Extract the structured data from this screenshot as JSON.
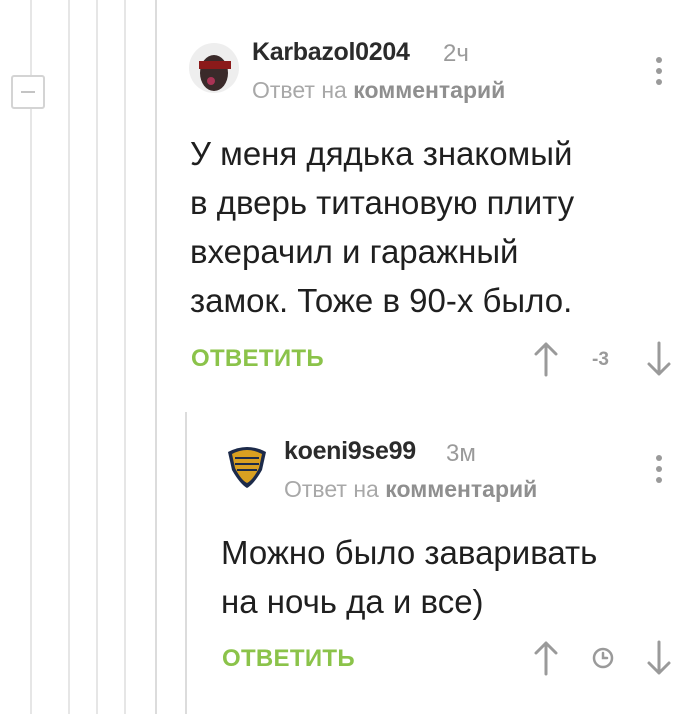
{
  "comments": [
    {
      "author": "Karbazol0204",
      "time": "2ч",
      "reply_prefix": "Ответ на",
      "reply_link": "комментарий",
      "body_lines": [
        "У меня дядька знакомый",
        "в дверь титановую плиту",
        "вхерачил и гаражный",
        "замок. Тоже в 90-х было."
      ],
      "reply_label": "ОТВЕТИТЬ",
      "rating": "-3"
    },
    {
      "author": "koeni9se99",
      "time": "3м",
      "reply_prefix": "Ответ на",
      "reply_link": "комментарий",
      "body_lines": [
        "Можно было заваривать",
        "на ночь да и все)"
      ],
      "reply_label": "ОТВЕТИТЬ"
    }
  ],
  "colors": {
    "accent": "#8bc34a",
    "muted": "#9a9a9a",
    "thread_line": "#e6e6e6"
  },
  "icons": [
    "collapse-icon",
    "avatar",
    "more-vert-icon",
    "arrow-up-icon",
    "arrow-down-icon",
    "clock-icon"
  ]
}
